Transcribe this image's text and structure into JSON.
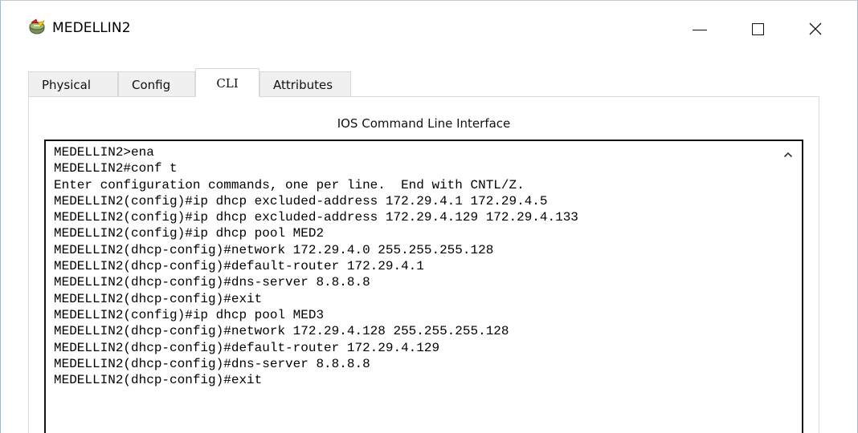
{
  "window": {
    "title": "MEDELLIN2",
    "icon": "router-icon",
    "controls": {
      "minimize": "minimize",
      "maximize": "maximize",
      "close": "close"
    }
  },
  "tabs": [
    {
      "label": "Physical",
      "active": false
    },
    {
      "label": "Config",
      "active": false
    },
    {
      "label": "CLI",
      "active": true
    },
    {
      "label": "Attributes",
      "active": false
    }
  ],
  "panel": {
    "heading": "IOS Command Line Interface"
  },
  "console": {
    "lines": [
      "MEDELLIN2>ena",
      "MEDELLIN2#conf t",
      "Enter configuration commands, one per line.  End with CNTL/Z.",
      "MEDELLIN2(config)#ip dhcp excluded-address 172.29.4.1 172.29.4.5",
      "MEDELLIN2(config)#ip dhcp excluded-address 172.29.4.129 172.29.4.133",
      "MEDELLIN2(config)#ip dhcp pool MED2",
      "MEDELLIN2(dhcp-config)#network 172.29.4.0 255.255.255.128",
      "MEDELLIN2(dhcp-config)#default-router 172.29.4.1",
      "MEDELLIN2(dhcp-config)#dns-server 8.8.8.8",
      "MEDELLIN2(dhcp-config)#exit",
      "MEDELLIN2(config)#ip dhcp pool MED3",
      "MEDELLIN2(dhcp-config)#network 172.29.4.128 255.255.255.128",
      "MEDELLIN2(dhcp-config)#default-router 172.29.4.129",
      "MEDELLIN2(dhcp-config)#dns-server 8.8.8.8",
      "MEDELLIN2(dhcp-config)#exit"
    ]
  }
}
